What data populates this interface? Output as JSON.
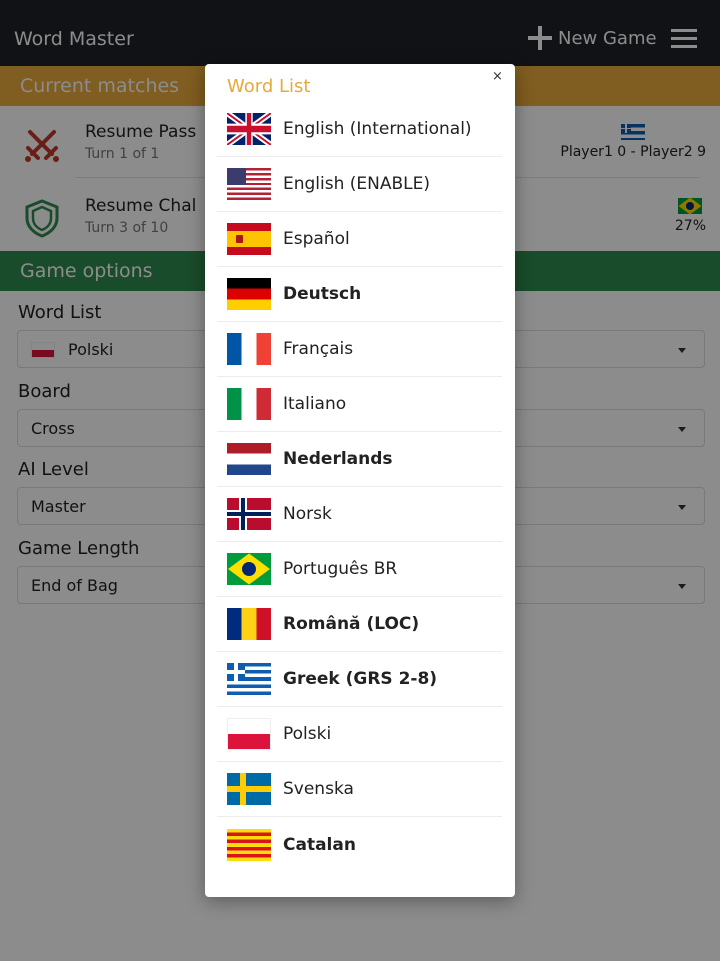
{
  "app": {
    "title": "Word Master",
    "new_game_label": "New Game"
  },
  "current_matches": {
    "header": "Current matches",
    "items": [
      {
        "title": "Resume Pass",
        "subtitle": "Turn 1 of 1",
        "flag": "greece",
        "right_text": "Player1 0 - Player2 9",
        "icon": "crossed-swords-icon",
        "icon_color": "#c0392b"
      },
      {
        "title": "Resume Chal",
        "subtitle": "Turn 3 of 10",
        "flag": "brazil",
        "right_text": "27%",
        "icon": "shield-icon",
        "icon_color": "#2e8b4e"
      }
    ]
  },
  "game_options": {
    "header": "Game options",
    "word_list": {
      "label": "Word List",
      "value": "Polski",
      "flag": "poland"
    },
    "board": {
      "label": "Board",
      "value": "Cross"
    },
    "ai_level": {
      "label": "AI Level",
      "value": "Master"
    },
    "game_length": {
      "label": "Game Length",
      "value": "End of Bag"
    }
  },
  "dialog": {
    "title": "Word List",
    "close_label": "×",
    "languages": [
      {
        "name": "English (International)",
        "flag": "uk",
        "bold": false
      },
      {
        "name": "English (ENABLE)",
        "flag": "us",
        "bold": false
      },
      {
        "name": "Español",
        "flag": "spain",
        "bold": false
      },
      {
        "name": "Deutsch",
        "flag": "germany",
        "bold": true
      },
      {
        "name": "Français",
        "flag": "france",
        "bold": false
      },
      {
        "name": "Italiano",
        "flag": "italy",
        "bold": false
      },
      {
        "name": "Nederlands",
        "flag": "netherlands",
        "bold": true
      },
      {
        "name": "Norsk",
        "flag": "norway",
        "bold": false
      },
      {
        "name": "Português BR",
        "flag": "brazil",
        "bold": false
      },
      {
        "name": "Română (LOC)",
        "flag": "romania",
        "bold": true
      },
      {
        "name": "Greek (GRS 2-8)",
        "flag": "greece",
        "bold": true
      },
      {
        "name": "Polski",
        "flag": "poland",
        "bold": false
      },
      {
        "name": "Svenska",
        "flag": "sweden",
        "bold": false
      },
      {
        "name": "Catalan",
        "flag": "catalonia",
        "bold": true
      }
    ]
  },
  "colors": {
    "accent_orange": "#e9a93b",
    "accent_green": "#2e8b4e",
    "appbar": "#1e2128",
    "dialog_title": "#e6a93a"
  }
}
